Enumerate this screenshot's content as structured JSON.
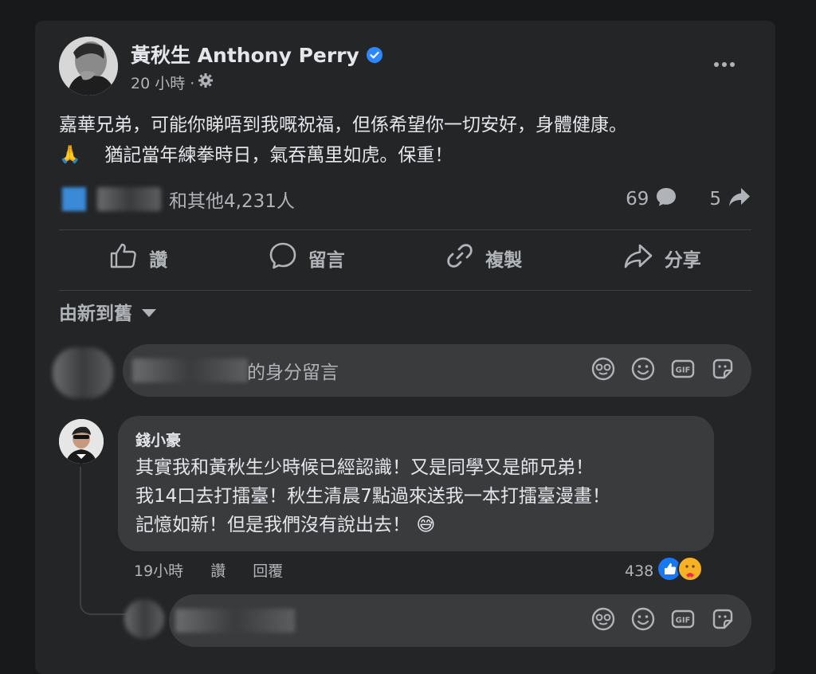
{
  "post": {
    "author": "黃秋生 Anthony Perry",
    "time": "20 小時 ·",
    "text_line1": "嘉華兄弟，可能你睇唔到我嘅祝福，但係希望你一切安好，身體健康。",
    "pray_emoji": "🙏",
    "text_line2": "猶記當年練拳時日，氣吞萬里如虎。保重！",
    "reactions_text": "和其他4,231人",
    "comment_count": "69",
    "share_count": "5"
  },
  "actions": {
    "like": "讚",
    "comment": "留言",
    "copy": "複製",
    "share": "分享"
  },
  "sort": {
    "label": "由新到舊"
  },
  "composer": {
    "placeholder_suffix": "的身分留言"
  },
  "comment": {
    "author": "錢小豪",
    "line1": "其實我和黃秋生少時候已經認識！又是同學又是師兄弟！",
    "line2": "我14口去打擂臺！秋生清晨7點過來送我一本打擂臺漫畫！",
    "line3": "記憶如新！但是我們沒有說出去！",
    "emoji": "😅",
    "time": "19小時",
    "like_label": "讚",
    "reply_label": "回覆",
    "reaction_count": "438"
  },
  "icons": [
    "verified-badge-icon",
    "gear-icon",
    "more-dots-icon",
    "comment-bubble-icon",
    "share-arrow-icon",
    "thumbs-up-icon",
    "link-icon",
    "avatar-frame-icon",
    "emoji-icon",
    "gif-icon",
    "sticker-icon",
    "like-reaction-icon",
    "care-reaction-icon"
  ],
  "colors": {
    "background": "#18191a",
    "card": "#242526",
    "bubble": "#3a3b3c",
    "text_primary": "#e4e6eb",
    "text_secondary": "#b0b3b8",
    "verified_blue": "#2d88ff"
  }
}
